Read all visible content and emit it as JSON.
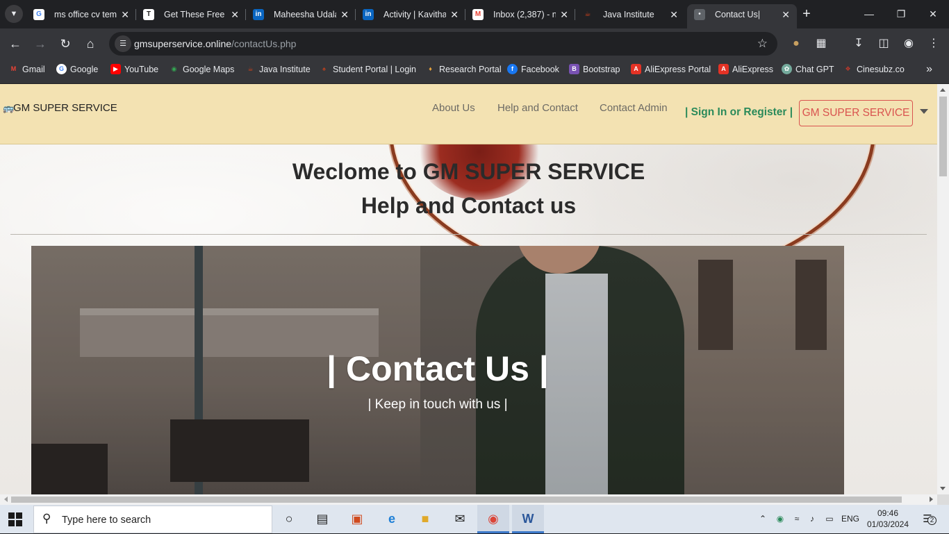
{
  "browser": {
    "tabs": [
      {
        "title": "ms office cv tem",
        "favicon": "google-g"
      },
      {
        "title": "Get These Free F",
        "favicon": "template-icon"
      },
      {
        "title": "Maheesha Udala",
        "favicon": "linkedin"
      },
      {
        "title": "Activity | Kavitha",
        "favicon": "linkedin"
      },
      {
        "title": "Inbox (2,387) - n",
        "favicon": "gmail"
      },
      {
        "title": "Java Institute",
        "favicon": "java-cup"
      },
      {
        "title": "Contact Us|",
        "favicon": "page-icon",
        "active": true
      }
    ],
    "url_host": "gmsuperservice.online",
    "url_path": "/contactUs.php",
    "bookmarks": [
      {
        "label": "Gmail",
        "icon": "gmail",
        "color": "#ea4335"
      },
      {
        "label": "Google",
        "icon": "google-g",
        "color": "#4285f4"
      },
      {
        "label": "YouTube",
        "icon": "youtube",
        "color": "#ff0000"
      },
      {
        "label": "Google Maps",
        "icon": "maps-pin",
        "color": "#34a853"
      },
      {
        "label": "Java Institute",
        "icon": "java-cup",
        "color": "#d0421b"
      },
      {
        "label": "Student Portal | Login",
        "icon": "portal-icon",
        "color": "#b04020"
      },
      {
        "label": "Research Portal",
        "icon": "research-icon",
        "color": "#e6a23c"
      },
      {
        "label": "Facebook",
        "icon": "facebook",
        "color": "#1877f2"
      },
      {
        "label": "Bootstrap",
        "icon": "bootstrap",
        "color": "#7952b3"
      },
      {
        "label": "AliExpress Portal",
        "icon": "aliexpress",
        "color": "#e43225"
      },
      {
        "label": "AliExpress",
        "icon": "aliexpress",
        "color": "#e43225"
      },
      {
        "label": "Chat GPT",
        "icon": "chatgpt",
        "color": "#74aa9c"
      },
      {
        "label": "Cinesubz.co",
        "icon": "cinesubz",
        "color": "#c0392b"
      }
    ]
  },
  "site": {
    "brand": "GM SUPER SERVICE",
    "nav": {
      "about": "About Us",
      "help": "Help and Contact",
      "contact_admin": "Contact Admin",
      "signin": "| Sign In or Register |",
      "account_button": "GM SUPER SERVICE"
    },
    "heading_welcome": "Weclome to GM SUPER SERVICE",
    "heading_help": "Help and Contact us",
    "hero": {
      "title": "| Contact Us |",
      "subtitle": "| Keep in touch with us |"
    },
    "colors": {
      "navbar_bg": "#f3e2b2",
      "signin_green": "#2a8a5a",
      "account_red": "#d9534f"
    }
  },
  "taskbar": {
    "search_placeholder": "Type here to search",
    "language": "ENG",
    "time": "09:46",
    "date": "01/03/2024",
    "notifications": "2"
  }
}
